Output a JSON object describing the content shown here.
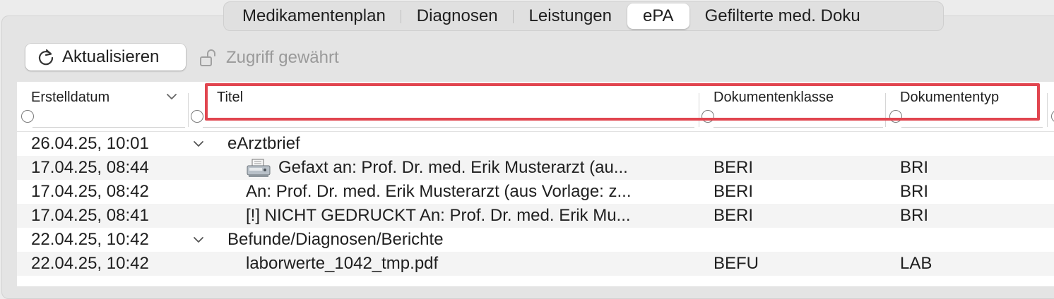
{
  "tabs": [
    {
      "label": "Medikamentenplan",
      "active": false
    },
    {
      "label": "Diagnosen",
      "active": false
    },
    {
      "label": "Leistungen",
      "active": false
    },
    {
      "label": "ePA",
      "active": true
    },
    {
      "label": "Gefilterte med. Doku",
      "active": false
    }
  ],
  "toolbar": {
    "refresh_label": "Aktualisieren",
    "refresh_icon": "refresh-icon",
    "access_label": "Zugriff gewährt",
    "access_icon": "unlocked-icon"
  },
  "columns": {
    "date": "Erstelldatum",
    "title": "Titel",
    "class": "Dokumentenklasse",
    "type": "Dokumententyp"
  },
  "rows": [
    {
      "date": "26.04.25, 10:01",
      "group": true,
      "title": "eArztbrief",
      "class": "",
      "type": ""
    },
    {
      "date": "17.04.25, 08:44",
      "group": false,
      "fax": true,
      "title": "Gefaxt an:  Prof. Dr. med. Erik Musterarzt (au...",
      "class": "BERI",
      "type": "BRI"
    },
    {
      "date": "17.04.25, 08:42",
      "group": false,
      "title": "An:  Prof. Dr. med. Erik Musterarzt (aus Vorlage: z...",
      "class": "BERI",
      "type": "BRI"
    },
    {
      "date": "17.04.25, 08:41",
      "group": false,
      "title": "[!] NICHT GEDRUCKT An:  Prof. Dr. med. Erik Mu...",
      "class": "BERI",
      "type": "BRI"
    },
    {
      "date": "22.04.25, 10:42",
      "group": true,
      "title": "Befunde/Diagnosen/Berichte",
      "class": "",
      "type": ""
    },
    {
      "date": "22.04.25, 10:42",
      "group": false,
      "title": "laborwerte_1042_tmp.pdf",
      "class": "BEFU",
      "type": "LAB"
    }
  ],
  "colors": {
    "highlight": "#e1454f",
    "accent": "#ffffff"
  }
}
